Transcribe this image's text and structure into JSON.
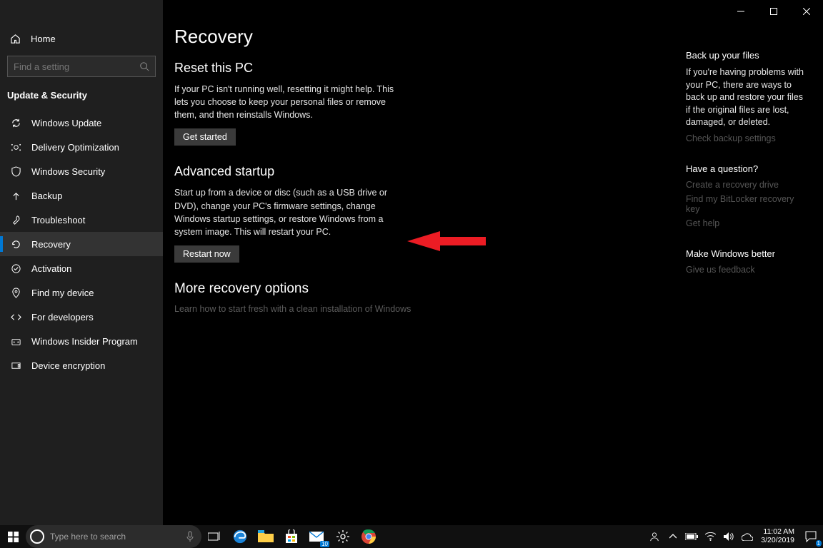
{
  "window": {
    "title": "Settings"
  },
  "sidebar": {
    "home": "Home",
    "search_placeholder": "Find a setting",
    "section": "Update & Security",
    "items": [
      {
        "label": "Windows Update",
        "icon": "sync-icon"
      },
      {
        "label": "Delivery Optimization",
        "icon": "delivery-icon"
      },
      {
        "label": "Windows Security",
        "icon": "shield-icon"
      },
      {
        "label": "Backup",
        "icon": "backup-icon"
      },
      {
        "label": "Troubleshoot",
        "icon": "troubleshoot-icon"
      },
      {
        "label": "Recovery",
        "icon": "recovery-icon",
        "selected": true
      },
      {
        "label": "Activation",
        "icon": "activation-icon"
      },
      {
        "label": "Find my device",
        "icon": "find-device-icon"
      },
      {
        "label": "For developers",
        "icon": "developers-icon"
      },
      {
        "label": "Windows Insider Program",
        "icon": "insider-icon"
      },
      {
        "label": "Device encryption",
        "icon": "encryption-icon"
      }
    ]
  },
  "page": {
    "title": "Recovery",
    "reset": {
      "heading": "Reset this PC",
      "body": "If your PC isn't running well, resetting it might help. This lets you choose to keep your personal files or remove them, and then reinstalls Windows.",
      "button": "Get started"
    },
    "advanced": {
      "heading": "Advanced startup",
      "body": "Start up from a device or disc (such as a USB drive or DVD), change your PC's firmware settings, change Windows startup settings, or restore Windows from a system image. This will restart your PC.",
      "button": "Restart now"
    },
    "more": {
      "heading": "More recovery options",
      "link": "Learn how to start fresh with a clean installation of Windows"
    }
  },
  "right": {
    "backup": {
      "heading": "Back up your files",
      "body": "If you're having problems with your PC, there are ways to back up and restore your files if the original files are lost, damaged, or deleted.",
      "link": "Check backup settings"
    },
    "question": {
      "heading": "Have a question?",
      "links": [
        "Create a recovery drive",
        "Find my BitLocker recovery key",
        "Get help"
      ]
    },
    "feedback": {
      "heading": "Make Windows better",
      "link": "Give us feedback"
    }
  },
  "taskbar": {
    "search_placeholder": "Type here to search",
    "mail_badge": "10",
    "time": "11:02 AM",
    "date": "3/20/2019",
    "notification_badge": "1"
  }
}
